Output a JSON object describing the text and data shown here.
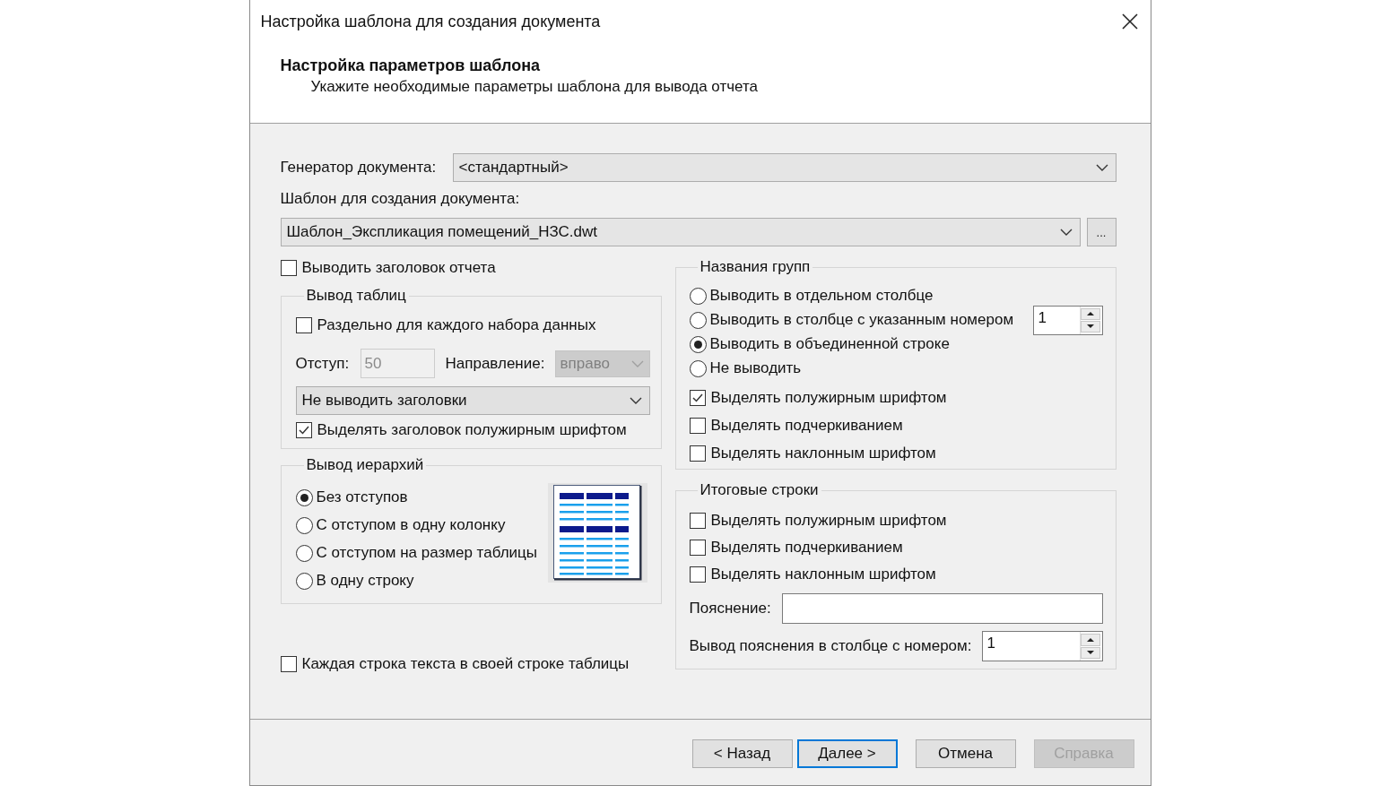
{
  "window": {
    "title": "Настройка шаблона для создания документа"
  },
  "header": {
    "title": "Настройка параметров шаблона",
    "subtitle": "Укажите необходимые параметры шаблона для вывода отчета"
  },
  "generator": {
    "label": "Генератор документа:",
    "value": "<стандартный>"
  },
  "template": {
    "label": "Шаблон для создания документа:",
    "value": "Шаблон_Экспликация помещений_НЗС.dwt",
    "browse_button": "..."
  },
  "report_title": {
    "label": "Выводить заголовок отчета",
    "checked": false
  },
  "table_output": {
    "title": "Вывод таблиц",
    "separate": {
      "label": "Раздельно для каждого набора данных",
      "checked": false
    },
    "indent": {
      "label": "Отступ:",
      "value": "50",
      "disabled": true
    },
    "direction": {
      "label": "Направление:",
      "value": "вправо",
      "disabled": true
    },
    "headers": {
      "value": "Не выводить заголовки"
    },
    "bold_header": {
      "label": "Выделять заголовок полужирным шрифтом",
      "checked": true
    }
  },
  "hierarchy_output": {
    "title": "Вывод иерархий",
    "options": [
      {
        "label": "Без отступов",
        "selected": true
      },
      {
        "label": "С отступом в одну колонку",
        "selected": false
      },
      {
        "label": "С отступом на размер таблицы",
        "selected": false
      },
      {
        "label": "В одну строку",
        "selected": false
      }
    ]
  },
  "each_line": {
    "label": "Каждая строка текста в своей строке таблицы",
    "checked": false
  },
  "group_names": {
    "title": "Названия групп",
    "options": [
      {
        "label": "Выводить в отдельном столбце",
        "selected": false
      },
      {
        "label": "Выводить в столбце с указанным номером",
        "selected": false,
        "number": "1"
      },
      {
        "label": "Выводить в объединенной строке",
        "selected": true
      },
      {
        "label": "Не выводить",
        "selected": false
      }
    ],
    "styles": [
      {
        "label": "Выделять полужирным шрифтом",
        "checked": true
      },
      {
        "label": "Выделять подчеркиванием",
        "checked": false
      },
      {
        "label": "Выделять наклонным шрифтом",
        "checked": false
      }
    ]
  },
  "totals": {
    "title": "Итоговые строки",
    "styles": [
      {
        "label": "Выделять полужирным шрифтом",
        "checked": false
      },
      {
        "label": "Выделять подчеркиванием",
        "checked": false
      },
      {
        "label": "Выделять наклонным шрифтом",
        "checked": false
      }
    ],
    "note": {
      "label": "Пояснение:"
    },
    "note_column": {
      "label": "Вывод пояснения в столбце с номером:",
      "value": "1"
    }
  },
  "buttons": [
    {
      "label": "< Назад",
      "default": false,
      "disabled": false
    },
    {
      "label": "Далее >",
      "default": true,
      "disabled": false
    },
    {
      "label": "Отмена",
      "default": false,
      "disabled": false
    },
    {
      "label": "Справка",
      "default": false,
      "disabled": true
    }
  ]
}
